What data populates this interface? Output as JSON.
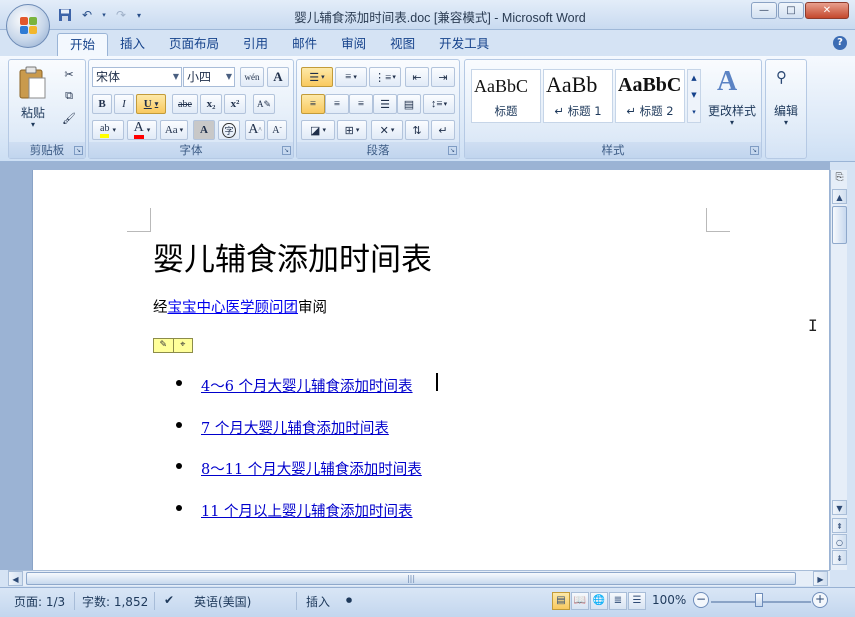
{
  "window": {
    "title": "婴儿辅食添加时间表.doc [兼容模式] - Microsoft Word",
    "minimize": "—",
    "maximize": "□",
    "close": "✕"
  },
  "qat": {
    "save_icon": "save-icon",
    "undo_icon": "undo-icon",
    "redo_icon": "redo-icon",
    "customize_icon": "qat-dropdown-icon"
  },
  "tabs": [
    {
      "label": "开始",
      "active": true
    },
    {
      "label": "插入"
    },
    {
      "label": "页面布局"
    },
    {
      "label": "引用"
    },
    {
      "label": "邮件"
    },
    {
      "label": "审阅"
    },
    {
      "label": "视图"
    },
    {
      "label": "开发工具"
    }
  ],
  "ribbon": {
    "clipboard": {
      "label": "剪贴板",
      "paste": "粘贴"
    },
    "font": {
      "label": "字体",
      "font_name": "宋体",
      "font_size": "小四",
      "wen": "wén",
      "bold": "B",
      "italic": "I",
      "underline": "U",
      "strike": "abe",
      "subscript": "x₂",
      "superscript": "x²",
      "grow": "A",
      "shrink": "A",
      "change_case": "Aa",
      "highlight": "ab",
      "font_color": "A",
      "shading": "A",
      "enclose": "字"
    },
    "paragraph": {
      "label": "段落"
    },
    "styles": {
      "label": "样式",
      "items": [
        {
          "sample": "AaBbC",
          "name": "标题"
        },
        {
          "sample": "AaBb",
          "name": "↵ 标题 1"
        },
        {
          "sample": "AaBbC",
          "name": "↵ 标题 2"
        }
      ],
      "change_styles": "更改样式"
    },
    "editing": {
      "label": "编辑"
    }
  },
  "document": {
    "title": "婴儿辅食添加时间表",
    "reviewed_prefix": "经",
    "reviewed_link": "宝宝中心医学顾问团",
    "reviewed_suffix": "审阅",
    "items": [
      "4～6 个月大婴儿辅食添加时间表 ",
      "7 个月大婴儿辅食添加时间表 ",
      "8～11 个月大婴儿辅食添加时间表 ",
      "11 个月以上婴儿辅食添加时间表 "
    ]
  },
  "status": {
    "page": "页面: 1/3",
    "words": "字数: 1,852",
    "language": "英语(美国)",
    "mode": "插入",
    "zoom": "100%"
  },
  "colors": {
    "accent": "#15428b",
    "link": "#0000cc",
    "highlight": "#ffff00",
    "font_color": "#ff0000"
  }
}
